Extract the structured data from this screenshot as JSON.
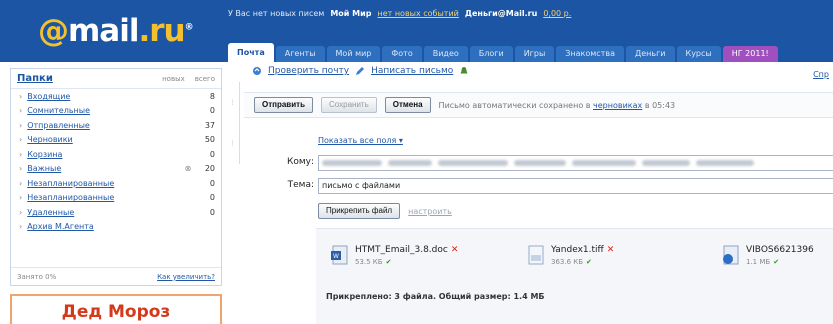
{
  "header": {
    "logo_at": "@",
    "logo_main": "mail",
    "logo_dot_ru": ".ru",
    "logo_reg": "®",
    "topline": {
      "text1": "У Вас нет новых писем",
      "section1_bold": "Мой Мир",
      "section1_link": "нет новых событий",
      "section2_bold": "Деньги@Mail.ru",
      "section2_link": "0,00 р."
    },
    "tabs": [
      "Почта",
      "Агенты",
      "Мой мир",
      "Фото",
      "Видео",
      "Блоги",
      "Игры",
      "Знакомства",
      "Деньги",
      "Курсы",
      "НГ 2011!"
    ]
  },
  "sidebar": {
    "title": "Папки",
    "col_new": "новых",
    "col_all": "всего",
    "folders": [
      {
        "name": "Входящие",
        "count": "8",
        "icon": ""
      },
      {
        "name": "Сомнительные",
        "count": "0",
        "icon": ""
      },
      {
        "name": "Отправленные",
        "count": "37",
        "icon": ""
      },
      {
        "name": "Черновики",
        "count": "50",
        "icon": ""
      },
      {
        "name": "Корзина",
        "count": "0",
        "icon": ""
      },
      {
        "name": "Важные",
        "count": "20",
        "icon": "⊗"
      },
      {
        "name": "Незапланированные",
        "count": "0",
        "icon": ""
      },
      {
        "name": "Незапланированные",
        "count": "0",
        "icon": ""
      },
      {
        "name": "Удаленные",
        "count": "0",
        "icon": ""
      },
      {
        "name": "Архив M.Агента",
        "count": "",
        "icon": ""
      }
    ],
    "footer_left": "Занято 0%",
    "footer_right": "Как увеличить?",
    "promo": "Дед Мороз"
  },
  "main": {
    "check_mail": "Проверить почту",
    "write_letter": "Написать письмо",
    "help": "Спр",
    "btn_send": "Отправить",
    "btn_save": "Сохранить",
    "btn_cancel": "Отмена",
    "autosave_text": "Письмо автоматически сохранено в",
    "autosave_link": "черновиках",
    "autosave_time": "в 05:43",
    "show_all": "Показать все поля ▾",
    "to_label": "Кому:",
    "subject_label": "Тема:",
    "subject_value": "письмо с файлами",
    "btn_attach": "Прикрепить файл",
    "link_settings": "настроить",
    "attachments": [
      {
        "name": "HTMT_Email_3.8.doc",
        "size": "53.5 КБ"
      },
      {
        "name": "Yandex1.tiff",
        "size": "363.6 КБ"
      },
      {
        "name": "VIBOS6621396",
        "size": "1.1 МБ"
      }
    ],
    "summary": "Прикреплено: 3 файла. Общий размер: 1.4 МБ"
  },
  "colors": {
    "header_blue": "#1b55a3",
    "logo_yellow": "#f4c12e",
    "link_blue": "#2158a8",
    "promo_red": "#d33a1c",
    "remove_red": "#d2261b",
    "ok_green": "#2e9a1e"
  }
}
